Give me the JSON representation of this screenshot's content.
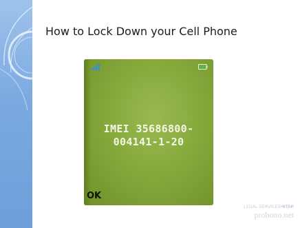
{
  "slide": {
    "title": "How to Lock Down your Cell Phone"
  },
  "phone_screen": {
    "imei_line1": "IMEI 35686800-",
    "imei_line2": "004141-1-20",
    "softkey_left": "OK",
    "icons": [
      "signal-strength-icon",
      "battery-icon"
    ]
  },
  "footer": {
    "org_prefix": "LEGAL SERVICES",
    "org_suffix": "NTAP",
    "site": "probono.net"
  },
  "colors": {
    "side_strip": "#7aa9e0",
    "screen_green": "#86a93c",
    "title_text": "#1b1b1b"
  }
}
